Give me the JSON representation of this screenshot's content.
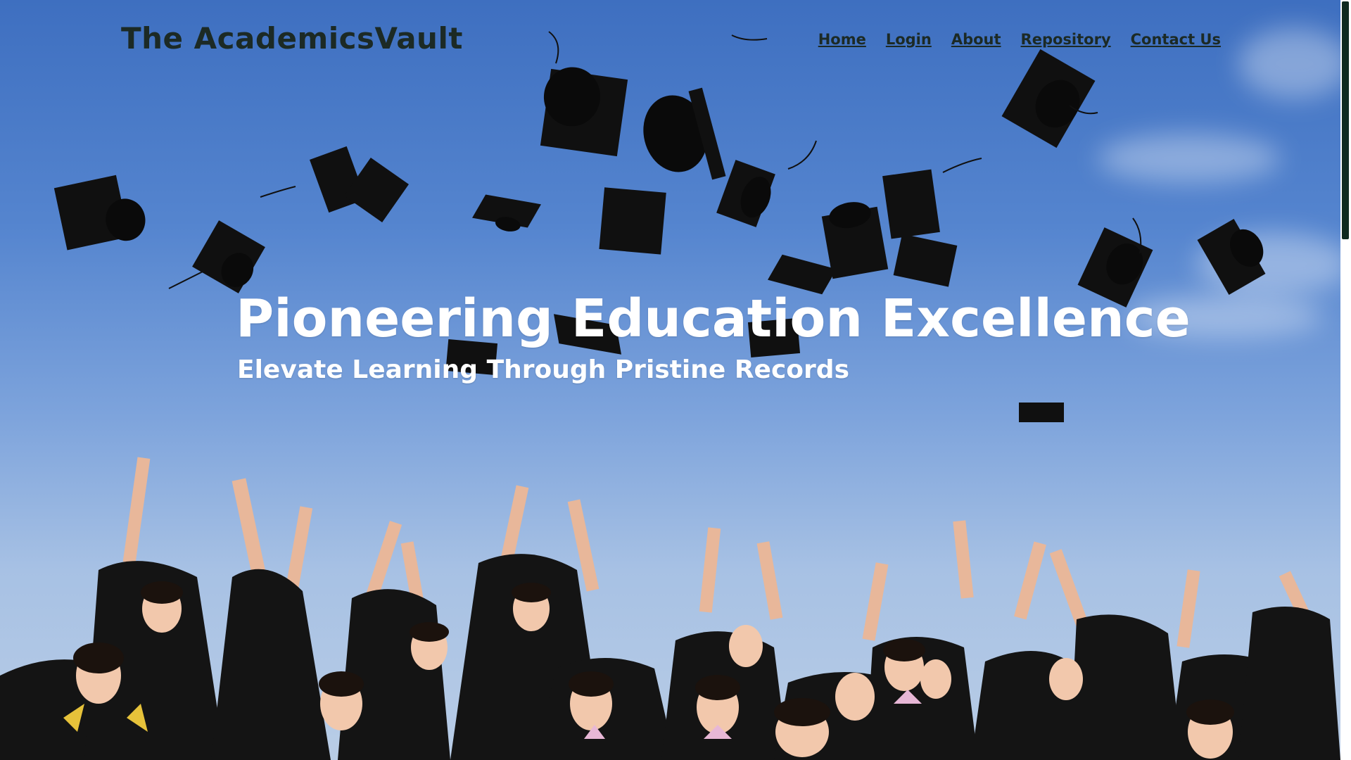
{
  "site": {
    "logo": "The AcademicsVault"
  },
  "nav": {
    "items": [
      {
        "label": "Home",
        "key": "home"
      },
      {
        "label": "Login",
        "key": "login"
      },
      {
        "label": "About",
        "key": "about"
      },
      {
        "label": "Repository",
        "key": "repository"
      },
      {
        "label": "Contact Us",
        "key": "contact"
      }
    ]
  },
  "hero": {
    "headline": "Pioneering Education Excellence",
    "subheadline": "Elevate Learning Through Pristine Records",
    "image_subject": "graduates throwing caps into blue sky"
  },
  "colors": {
    "nav_text": "#1c2a25",
    "hero_text": "#ffffff",
    "sky": "#5585cf",
    "scrollbar_thumb": "#0f2a20"
  },
  "scroll": {
    "position_fraction": 0.0,
    "visible_fraction": 0.31
  }
}
